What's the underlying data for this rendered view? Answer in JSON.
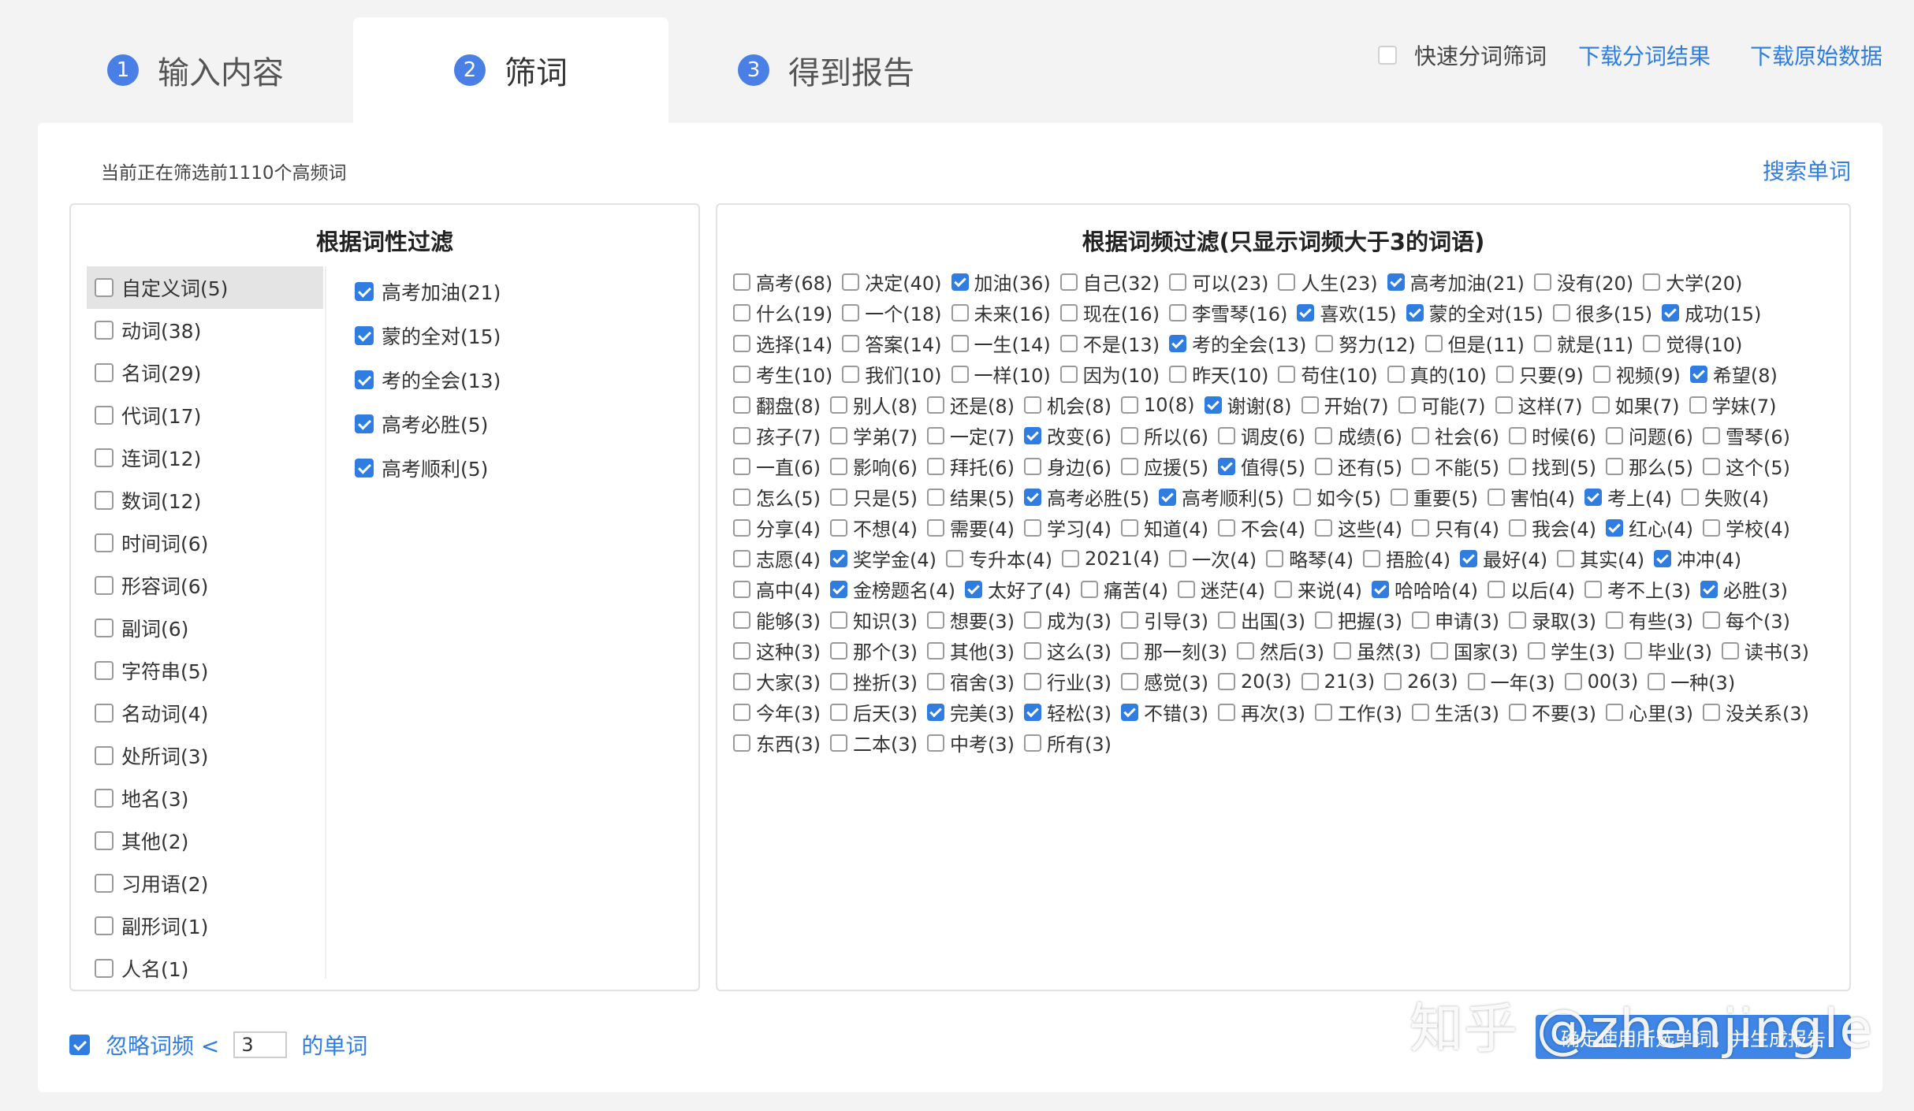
{
  "tabs": [
    {
      "num": "1",
      "label": "输入内容"
    },
    {
      "num": "2",
      "label": "筛词"
    },
    {
      "num": "3",
      "label": "得到报告"
    }
  ],
  "top_tools": {
    "quick_label": "快速分词筛词",
    "download_seg": "下载分词结果",
    "download_raw": "下载原始数据"
  },
  "status_text": "当前正在筛选前1110个高频词",
  "search_link": "搜索单词",
  "left_panel": {
    "title": "根据词性过滤",
    "pos": [
      {
        "label": "自定义词(5)",
        "checked": false
      },
      {
        "label": "动词(38)",
        "checked": false
      },
      {
        "label": "名词(29)",
        "checked": false
      },
      {
        "label": "代词(17)",
        "checked": false
      },
      {
        "label": "连词(12)",
        "checked": false
      },
      {
        "label": "数词(12)",
        "checked": false
      },
      {
        "label": "时间词(6)",
        "checked": false
      },
      {
        "label": "形容词(6)",
        "checked": false
      },
      {
        "label": "副词(6)",
        "checked": false
      },
      {
        "label": "字符串(5)",
        "checked": false
      },
      {
        "label": "名动词(4)",
        "checked": false
      },
      {
        "label": "处所词(3)",
        "checked": false
      },
      {
        "label": "地名(3)",
        "checked": false
      },
      {
        "label": "其他(2)",
        "checked": false
      },
      {
        "label": "习用语(2)",
        "checked": false
      },
      {
        "label": "副形词(1)",
        "checked": false
      },
      {
        "label": "人名(1)",
        "checked": false
      }
    ],
    "selected": [
      {
        "label": "高考加油(21)",
        "checked": true
      },
      {
        "label": "蒙的全对(15)",
        "checked": true
      },
      {
        "label": "考的全会(13)",
        "checked": true
      },
      {
        "label": "高考必胜(5)",
        "checked": true
      },
      {
        "label": "高考顺利(5)",
        "checked": true
      }
    ]
  },
  "right_panel": {
    "title": "根据词频过滤(只显示词频大于3的词语)",
    "words": [
      {
        "label": "高考(68)",
        "checked": false
      },
      {
        "label": "决定(40)",
        "checked": false
      },
      {
        "label": "加油(36)",
        "checked": true
      },
      {
        "label": "自己(32)",
        "checked": false
      },
      {
        "label": "可以(23)",
        "checked": false
      },
      {
        "label": "人生(23)",
        "checked": false
      },
      {
        "label": "高考加油(21)",
        "checked": true
      },
      {
        "label": "没有(20)",
        "checked": false
      },
      {
        "label": "大学(20)",
        "checked": false
      },
      {
        "label": "什么(19)",
        "checked": false
      },
      {
        "label": "一个(18)",
        "checked": false
      },
      {
        "label": "未来(16)",
        "checked": false
      },
      {
        "label": "现在(16)",
        "checked": false
      },
      {
        "label": "李雪琴(16)",
        "checked": false
      },
      {
        "label": "喜欢(15)",
        "checked": true
      },
      {
        "label": "蒙的全对(15)",
        "checked": true
      },
      {
        "label": "很多(15)",
        "checked": false
      },
      {
        "label": "成功(15)",
        "checked": true
      },
      {
        "label": "选择(14)",
        "checked": false
      },
      {
        "label": "答案(14)",
        "checked": false
      },
      {
        "label": "一生(14)",
        "checked": false
      },
      {
        "label": "不是(13)",
        "checked": false
      },
      {
        "label": "考的全会(13)",
        "checked": true
      },
      {
        "label": "努力(12)",
        "checked": false
      },
      {
        "label": "但是(11)",
        "checked": false
      },
      {
        "label": "就是(11)",
        "checked": false
      },
      {
        "label": "觉得(10)",
        "checked": false
      },
      {
        "label": "考生(10)",
        "checked": false
      },
      {
        "label": "我们(10)",
        "checked": false
      },
      {
        "label": "一样(10)",
        "checked": false
      },
      {
        "label": "因为(10)",
        "checked": false
      },
      {
        "label": "昨天(10)",
        "checked": false
      },
      {
        "label": "苟住(10)",
        "checked": false
      },
      {
        "label": "真的(10)",
        "checked": false
      },
      {
        "label": "只要(9)",
        "checked": false
      },
      {
        "label": "视频(9)",
        "checked": false
      },
      {
        "label": "希望(8)",
        "checked": true
      },
      {
        "label": "翻盘(8)",
        "checked": false
      },
      {
        "label": "别人(8)",
        "checked": false
      },
      {
        "label": "还是(8)",
        "checked": false
      },
      {
        "label": "机会(8)",
        "checked": false
      },
      {
        "label": "10(8)",
        "checked": false
      },
      {
        "label": "谢谢(8)",
        "checked": true
      },
      {
        "label": "开始(7)",
        "checked": false
      },
      {
        "label": "可能(7)",
        "checked": false
      },
      {
        "label": "这样(7)",
        "checked": false
      },
      {
        "label": "如果(7)",
        "checked": false
      },
      {
        "label": "学妹(7)",
        "checked": false
      },
      {
        "label": "孩子(7)",
        "checked": false
      },
      {
        "label": "学弟(7)",
        "checked": false
      },
      {
        "label": "一定(7)",
        "checked": false
      },
      {
        "label": "改变(6)",
        "checked": true
      },
      {
        "label": "所以(6)",
        "checked": false
      },
      {
        "label": "调皮(6)",
        "checked": false
      },
      {
        "label": "成绩(6)",
        "checked": false
      },
      {
        "label": "社会(6)",
        "checked": false
      },
      {
        "label": "时候(6)",
        "checked": false
      },
      {
        "label": "问题(6)",
        "checked": false
      },
      {
        "label": "雪琴(6)",
        "checked": false
      },
      {
        "label": "一直(6)",
        "checked": false
      },
      {
        "label": "影响(6)",
        "checked": false
      },
      {
        "label": "拜托(6)",
        "checked": false
      },
      {
        "label": "身边(6)",
        "checked": false
      },
      {
        "label": "应援(5)",
        "checked": false
      },
      {
        "label": "值得(5)",
        "checked": true
      },
      {
        "label": "还有(5)",
        "checked": false
      },
      {
        "label": "不能(5)",
        "checked": false
      },
      {
        "label": "找到(5)",
        "checked": false
      },
      {
        "label": "那么(5)",
        "checked": false
      },
      {
        "label": "这个(5)",
        "checked": false
      },
      {
        "label": "怎么(5)",
        "checked": false
      },
      {
        "label": "只是(5)",
        "checked": false
      },
      {
        "label": "结果(5)",
        "checked": false
      },
      {
        "label": "高考必胜(5)",
        "checked": true
      },
      {
        "label": "高考顺利(5)",
        "checked": true
      },
      {
        "label": "如今(5)",
        "checked": false
      },
      {
        "label": "重要(5)",
        "checked": false
      },
      {
        "label": "害怕(4)",
        "checked": false
      },
      {
        "label": "考上(4)",
        "checked": true
      },
      {
        "label": "失败(4)",
        "checked": false
      },
      {
        "label": "分享(4)",
        "checked": false
      },
      {
        "label": "不想(4)",
        "checked": false
      },
      {
        "label": "需要(4)",
        "checked": false
      },
      {
        "label": "学习(4)",
        "checked": false
      },
      {
        "label": "知道(4)",
        "checked": false
      },
      {
        "label": "不会(4)",
        "checked": false
      },
      {
        "label": "这些(4)",
        "checked": false
      },
      {
        "label": "只有(4)",
        "checked": false
      },
      {
        "label": "我会(4)",
        "checked": false
      },
      {
        "label": "红心(4)",
        "checked": true
      },
      {
        "label": "学校(4)",
        "checked": false
      },
      {
        "label": "志愿(4)",
        "checked": false
      },
      {
        "label": "奖学金(4)",
        "checked": true
      },
      {
        "label": "专升本(4)",
        "checked": false
      },
      {
        "label": "2021(4)",
        "checked": false
      },
      {
        "label": "一次(4)",
        "checked": false
      },
      {
        "label": "略琴(4)",
        "checked": false
      },
      {
        "label": "捂脸(4)",
        "checked": false
      },
      {
        "label": "最好(4)",
        "checked": true
      },
      {
        "label": "其实(4)",
        "checked": false
      },
      {
        "label": "冲冲(4)",
        "checked": true
      },
      {
        "label": "高中(4)",
        "checked": false
      },
      {
        "label": "金榜题名(4)",
        "checked": true
      },
      {
        "label": "太好了(4)",
        "checked": true
      },
      {
        "label": "痛苦(4)",
        "checked": false
      },
      {
        "label": "迷茫(4)",
        "checked": false
      },
      {
        "label": "来说(4)",
        "checked": false
      },
      {
        "label": "哈哈哈(4)",
        "checked": true
      },
      {
        "label": "以后(4)",
        "checked": false
      },
      {
        "label": "考不上(3)",
        "checked": false
      },
      {
        "label": "必胜(3)",
        "checked": true
      },
      {
        "label": "能够(3)",
        "checked": false
      },
      {
        "label": "知识(3)",
        "checked": false
      },
      {
        "label": "想要(3)",
        "checked": false
      },
      {
        "label": "成为(3)",
        "checked": false
      },
      {
        "label": "引导(3)",
        "checked": false
      },
      {
        "label": "出国(3)",
        "checked": false
      },
      {
        "label": "把握(3)",
        "checked": false
      },
      {
        "label": "申请(3)",
        "checked": false
      },
      {
        "label": "录取(3)",
        "checked": false
      },
      {
        "label": "有些(3)",
        "checked": false
      },
      {
        "label": "每个(3)",
        "checked": false
      },
      {
        "label": "这种(3)",
        "checked": false
      },
      {
        "label": "那个(3)",
        "checked": false
      },
      {
        "label": "其他(3)",
        "checked": false
      },
      {
        "label": "这么(3)",
        "checked": false
      },
      {
        "label": "那一刻(3)",
        "checked": false
      },
      {
        "label": "然后(3)",
        "checked": false
      },
      {
        "label": "虽然(3)",
        "checked": false
      },
      {
        "label": "国家(3)",
        "checked": false
      },
      {
        "label": "学生(3)",
        "checked": false
      },
      {
        "label": "毕业(3)",
        "checked": false
      },
      {
        "label": "读书(3)",
        "checked": false
      },
      {
        "label": "大家(3)",
        "checked": false
      },
      {
        "label": "挫折(3)",
        "checked": false
      },
      {
        "label": "宿舍(3)",
        "checked": false
      },
      {
        "label": "行业(3)",
        "checked": false
      },
      {
        "label": "感觉(3)",
        "checked": false
      },
      {
        "label": "20(3)",
        "checked": false
      },
      {
        "label": "21(3)",
        "checked": false
      },
      {
        "label": "26(3)",
        "checked": false
      },
      {
        "label": "一年(3)",
        "checked": false
      },
      {
        "label": "00(3)",
        "checked": false
      },
      {
        "label": "一种(3)",
        "checked": false
      },
      {
        "label": "今年(3)",
        "checked": false
      },
      {
        "label": "后天(3)",
        "checked": false
      },
      {
        "label": "完美(3)",
        "checked": true
      },
      {
        "label": "轻松(3)",
        "checked": true
      },
      {
        "label": "不错(3)",
        "checked": true
      },
      {
        "label": "再次(3)",
        "checked": false
      },
      {
        "label": "工作(3)",
        "checked": false
      },
      {
        "label": "生活(3)",
        "checked": false
      },
      {
        "label": "不要(3)",
        "checked": false
      },
      {
        "label": "心里(3)",
        "checked": false
      },
      {
        "label": "没关系(3)",
        "checked": false
      },
      {
        "label": "东西(3)",
        "checked": false
      },
      {
        "label": "二本(3)",
        "checked": false
      },
      {
        "label": "中考(3)",
        "checked": false
      },
      {
        "label": "所有(3)",
        "checked": false
      }
    ]
  },
  "bottom": {
    "ignore_label": "忽略词频 <",
    "ignore_value": "3",
    "ignore_suffix": "的单词",
    "ignore_checked": true,
    "confirm_label": "确定使用所选单词，并生成报告"
  },
  "watermark": "知乎 @zhenjingle",
  "colors": {
    "accent": "#2f7de1",
    "tab_badge": "#4a7fe6",
    "button": "#3f86e6"
  }
}
